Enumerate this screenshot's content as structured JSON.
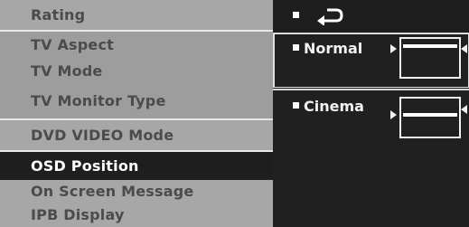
{
  "menu": {
    "items": [
      {
        "label": "Rating"
      },
      {
        "label": "TV Aspect"
      },
      {
        "label": "TV Mode"
      },
      {
        "label": "TV Monitor Type"
      },
      {
        "label": "DVD VIDEO Mode"
      },
      {
        "label": "OSD Position"
      },
      {
        "label": "On Screen Message"
      },
      {
        "label": "IPB Display"
      }
    ],
    "selected_index": 5
  },
  "panel": {
    "header_icon": "return-arrow-icon",
    "options": [
      {
        "label": "Normal",
        "icon": "screen-position-normal-icon",
        "selected": true
      },
      {
        "label": "Cinema",
        "icon": "screen-position-cinema-icon",
        "selected": false
      }
    ]
  }
}
